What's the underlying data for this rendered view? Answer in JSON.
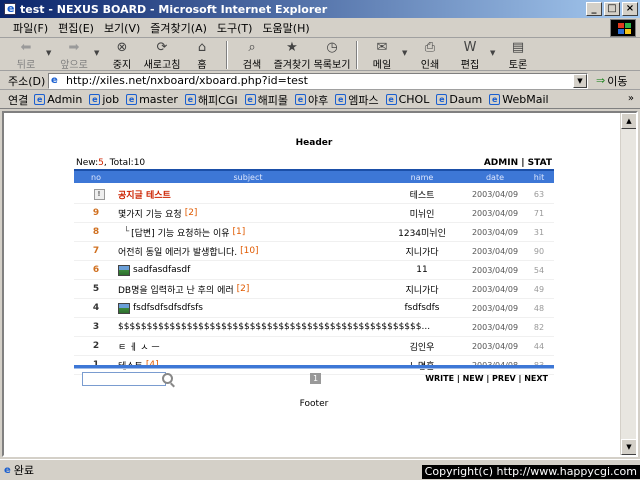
{
  "window": {
    "title": "test - NEXUS BOARD - Microsoft Internet Explorer"
  },
  "menu": [
    "파일(F)",
    "편집(E)",
    "보기(V)",
    "즐겨찾기(A)",
    "도구(T)",
    "도움말(H)"
  ],
  "toolbar": {
    "back": "뒤로",
    "forward": "앞으로",
    "stop": "중지",
    "refresh": "새로고침",
    "home": "홈",
    "search": "검색",
    "favorites": "즐겨찾기",
    "history": "목록보기",
    "mail": "메일",
    "print": "인쇄",
    "edit": "편집",
    "discuss": "토론"
  },
  "address": {
    "label": "주소(D)",
    "url": "http://xiles.net/nxboard/xboard.php?id=test",
    "go": "이동"
  },
  "links": {
    "label": "연결",
    "items": [
      "Admin",
      "job",
      "master",
      "해피CGI",
      "해피몰",
      "야후",
      "엠파스",
      "CHOL",
      "Daum",
      "WebMail"
    ]
  },
  "board": {
    "header": "Header",
    "new_label": "New:",
    "new_count": "5",
    "total_label": ", Total:",
    "total_count": "10",
    "admin_stat": "ADMIN | STAT",
    "columns": {
      "no": "no",
      "subject": "subject",
      "name": "name",
      "date": "date",
      "hit": "hit"
    },
    "rows": [
      {
        "no": "",
        "subject": "공지글 테스트",
        "comments": "",
        "name": "테스트",
        "date": "2003/04/09",
        "hit": "63"
      },
      {
        "no": "9",
        "subject": "몇가지 기능 요청",
        "comments": "[2]",
        "name": "미뉘인",
        "date": "2003/04/09",
        "hit": "71"
      },
      {
        "no": "8",
        "subject": "[답변] 기능 요청하는 이유",
        "comments": "[1]",
        "name": "1234미뉘인",
        "date": "2003/04/09",
        "hit": "31"
      },
      {
        "no": "7",
        "subject": "어전히 동일 에러가 발생합니다.",
        "comments": "[10]",
        "name": "지니가다",
        "date": "2003/04/09",
        "hit": "90"
      },
      {
        "no": "6",
        "subject": "sadfasdfasdf",
        "comments": "",
        "name": "11",
        "date": "2003/04/09",
        "hit": "54"
      },
      {
        "no": "5",
        "subject": "DB명을 입력하고 난 후의 에러",
        "comments": "[2]",
        "name": "지니가다",
        "date": "2003/04/09",
        "hit": "49"
      },
      {
        "no": "4",
        "subject": "fsdfsdfsdfsdfsfs",
        "comments": "",
        "name": "fsdfsdfs",
        "date": "2003/04/09",
        "hit": "48"
      },
      {
        "no": "3",
        "subject": "$$$$$$$$$$$$$$$$$$$$$$$$$$$$$$$$$$$$$$$$$$$$$$$$$$$$$...",
        "comments": "",
        "name": "",
        "date": "2003/04/09",
        "hit": "82"
      },
      {
        "no": "2",
        "subject": "ㅌ ㅔ ㅅ ㅡ",
        "comments": "",
        "name": "김인우",
        "date": "2003/04/09",
        "hit": "44"
      },
      {
        "no": "1",
        "subject": "테스트",
        "comments": "[4]",
        "name": "노명훈",
        "date": "2003/04/08",
        "hit": "83"
      }
    ],
    "page": "1",
    "nav": "WRITE | NEW | PREV | NEXT",
    "footer": "Footer"
  },
  "status": {
    "text": "완료",
    "copyright": "Copyright(c) http://www.happycgi.com"
  }
}
